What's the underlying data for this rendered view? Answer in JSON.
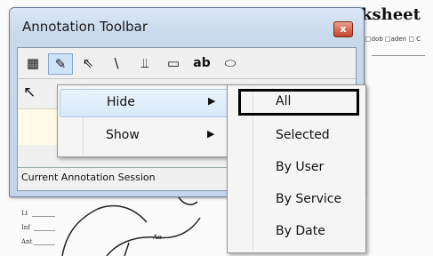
{
  "window": {
    "title": "Annotation Toolbar",
    "close_glyph": "x"
  },
  "background": {
    "heading": "ksheet",
    "fields": "□dob □aden □ C",
    "labels": [
      "Lt",
      "Inf",
      "Ant",
      "Ao"
    ]
  },
  "toolbar": {
    "tools": [
      {
        "name": "color-palette-icon",
        "glyph": "▦"
      },
      {
        "name": "edit-annotation-icon",
        "glyph": "✎"
      },
      {
        "name": "select-pointer-icon",
        "glyph": "⇖"
      },
      {
        "name": "line-icon",
        "glyph": "\\"
      },
      {
        "name": "freehand-icon",
        "glyph": "⫫"
      },
      {
        "name": "rectangle-icon",
        "glyph": "▭"
      },
      {
        "name": "text-icon",
        "glyph": "ab"
      },
      {
        "name": "ellipse-icon",
        "glyph": "⬭"
      }
    ],
    "arrow_tool_glyph": "↖"
  },
  "status": {
    "text": "Current Annotation Session"
  },
  "context_menu": {
    "items": [
      {
        "label": "Hide",
        "arrow": "▶"
      },
      {
        "label": "Show",
        "arrow": "▶"
      }
    ]
  },
  "submenu": {
    "items": [
      {
        "label": "All"
      },
      {
        "label": "Selected"
      },
      {
        "label": "By User"
      },
      {
        "label": "By Service"
      },
      {
        "label": "By Date"
      }
    ]
  },
  "colors": {
    "accent": "#cfe3f7",
    "menu_bg": "#f5f5f5",
    "close_red": "#c8432a"
  }
}
